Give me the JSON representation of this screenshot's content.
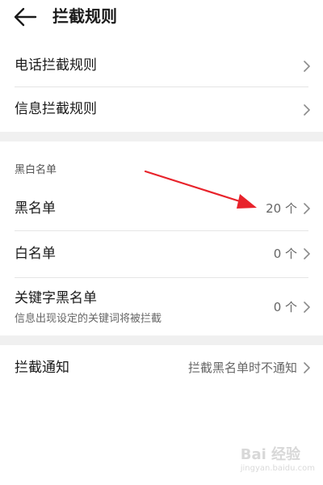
{
  "header": {
    "title": "拦截规则"
  },
  "rules": [
    {
      "label": "电话拦截规则"
    },
    {
      "label": "信息拦截规则"
    }
  ],
  "blacklist_section": {
    "heading": "黑白名单",
    "items": [
      {
        "label": "黑名单",
        "value": "20 个"
      },
      {
        "label": "白名单",
        "value": "0 个"
      },
      {
        "label": "关键字黑名单",
        "sub": "信息出现设定的关键词将被拦截",
        "value": "0 个"
      }
    ]
  },
  "notification": {
    "label": "拦截通知",
    "value": "拦截黑名单时不通知"
  },
  "watermark": {
    "brand": "Bai 经验",
    "site": "jingyan.baidu.com"
  },
  "colors": {
    "annotation_arrow": "#e8232b",
    "band": "#f0f0f0"
  }
}
